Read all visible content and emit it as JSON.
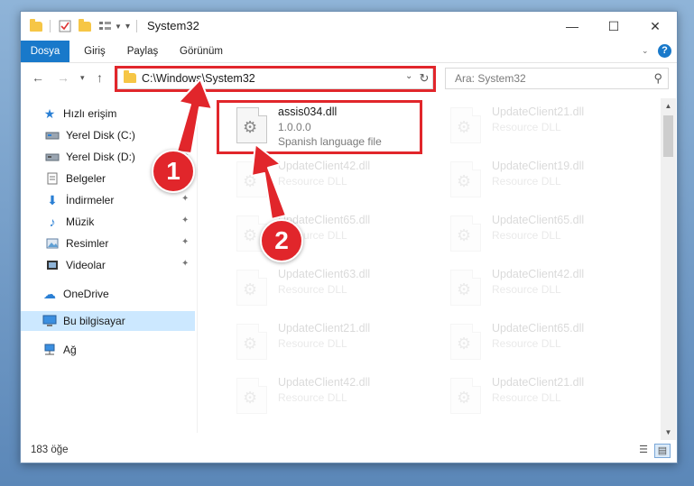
{
  "window": {
    "title": "System32",
    "minimize_glyph": "—",
    "maximize_glyph": "☐",
    "close_glyph": "✕"
  },
  "ribbon": {
    "tabs": [
      {
        "label": "Dosya"
      },
      {
        "label": "Giriş"
      },
      {
        "label": "Paylaş"
      },
      {
        "label": "Görünüm"
      }
    ],
    "help_glyph": "?"
  },
  "address": {
    "path": "C:\\Windows\\System32",
    "search_placeholder": "Ara: System32"
  },
  "nav_pane": {
    "items": [
      {
        "label": "Hızlı erişim",
        "icon": "star-icon"
      },
      {
        "label": "Yerel Disk (C:)",
        "icon": "drive-icon"
      },
      {
        "label": "Yerel Disk (D:)",
        "icon": "drive-icon"
      },
      {
        "label": "Belgeler",
        "icon": "documents-icon"
      },
      {
        "label": "İndirmeler",
        "icon": "download-icon"
      },
      {
        "label": "Müzik",
        "icon": "music-icon"
      },
      {
        "label": "Resimler",
        "icon": "pictures-icon"
      },
      {
        "label": "Videolar",
        "icon": "videos-icon"
      },
      {
        "label": "OneDrive",
        "icon": "cloud-icon"
      },
      {
        "label": "Bu bilgisayar",
        "icon": "computer-icon"
      },
      {
        "label": "Ağ",
        "icon": "network-icon"
      }
    ]
  },
  "files": [
    {
      "name": "assis034.dll",
      "line2": "1.0.0.0",
      "line3": "Spanish language file"
    },
    {
      "name": "UpdateClient21.dll",
      "line2": "Resource DLL"
    },
    {
      "name": "UpdateClient42.dll",
      "line2": "Resource DLL"
    },
    {
      "name": "UpdateClient19.dll",
      "line2": "Resource DLL"
    },
    {
      "name": "UpdateClient65.dll",
      "line2": "Resource DLL"
    },
    {
      "name": "UpdateClient65.dll",
      "line2": "Resource DLL"
    },
    {
      "name": "UpdateClient63.dll",
      "line2": "Resource DLL"
    },
    {
      "name": "UpdateClient42.dll",
      "line2": "Resource DLL"
    },
    {
      "name": "UpdateClient21.dll",
      "line2": "Resource DLL"
    },
    {
      "name": "UpdateClient65.dll",
      "line2": "Resource DLL"
    },
    {
      "name": "UpdateClient42.dll",
      "line2": "Resource DLL"
    },
    {
      "name": "UpdateClient21.dll",
      "line2": "Resource DLL"
    }
  ],
  "status": {
    "item_count": "183 öğe"
  },
  "annotations": {
    "step1": "1",
    "step2": "2",
    "color": "#e1262b"
  }
}
